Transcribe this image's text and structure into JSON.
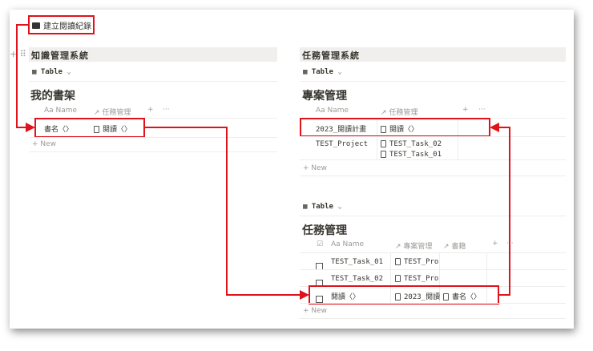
{
  "link": {
    "icon": "book-icon",
    "label": "建立閱讀紀錄"
  },
  "left": {
    "section": "知識管理系統",
    "view": "Table",
    "title": "我的書架",
    "columns": [
      "Aa Name",
      "任務管理"
    ],
    "rows": [
      {
        "name": "書名〈〉",
        "relation": "閱讀〈〉"
      }
    ],
    "new": "+ New"
  },
  "right_top": {
    "section": "任務管理系統",
    "view": "Table",
    "title": "專案管理",
    "columns": [
      "Aa Name",
      "任務管理"
    ],
    "rows": [
      {
        "name": "2023_閱讀計畫",
        "relations": [
          "閱讀〈〉"
        ]
      },
      {
        "name": "TEST_Project",
        "relations": [
          "TEST_Task_02",
          "TEST_Task_01"
        ]
      }
    ],
    "new": "+ New"
  },
  "right_bottom": {
    "view": "Table",
    "title": "任務管理",
    "columns": [
      "Aa Name",
      "專案管理",
      "書籍"
    ],
    "rows": [
      {
        "name": "TEST_Task_01",
        "project": "TEST_Pro",
        "book": ""
      },
      {
        "name": "TEST_Task_02",
        "project": "TEST_Pro",
        "book": ""
      },
      {
        "name": "閱讀〈〉",
        "project": "2023_閱讀",
        "book": "書名〈〉"
      }
    ],
    "new": "+ New"
  },
  "common": {
    "add": "+",
    "more": "···",
    "arrow": "↗",
    "chev": "⌄"
  },
  "colors": {
    "highlight": "#e0121b",
    "header_bg": "#f1efed"
  }
}
